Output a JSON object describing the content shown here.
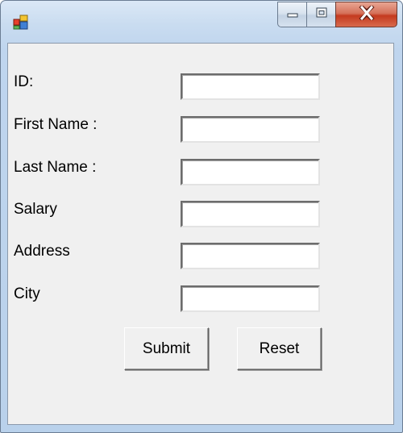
{
  "window": {
    "title": "",
    "icon": "windows-forms-app-icon"
  },
  "caption_buttons": {
    "minimize_icon": "minimize-icon",
    "maximize_icon": "maximize-icon",
    "close_icon": "close-icon"
  },
  "form": {
    "fields": [
      {
        "label": "ID:",
        "value": "",
        "placeholder": ""
      },
      {
        "label": "First Name :",
        "value": "",
        "placeholder": ""
      },
      {
        "label": "Last Name :",
        "value": "",
        "placeholder": ""
      },
      {
        "label": "Salary",
        "value": "",
        "placeholder": ""
      },
      {
        "label": "Address",
        "value": "",
        "placeholder": ""
      },
      {
        "label": "City",
        "value": "",
        "placeholder": ""
      }
    ],
    "submit_label": "Submit",
    "reset_label": "Reset"
  },
  "colors": {
    "client_background": "#f0f0f0",
    "close_button": "#c43a1f",
    "title_bar": "#c9dcf0"
  }
}
